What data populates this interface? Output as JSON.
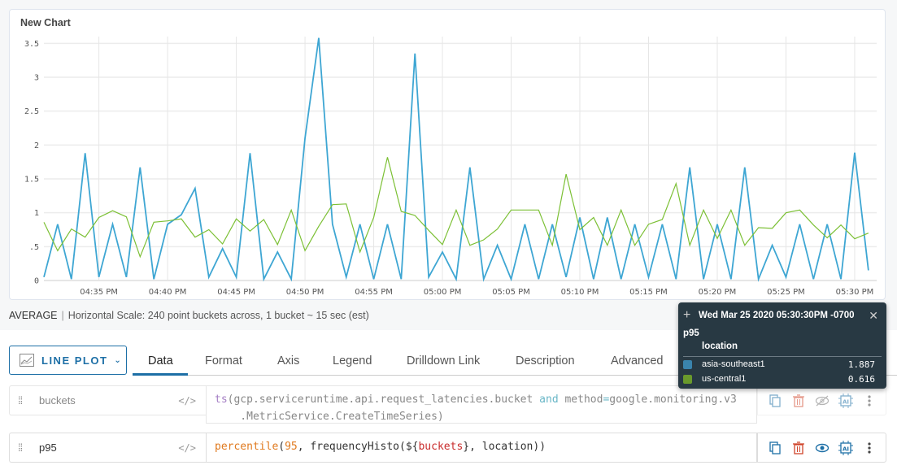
{
  "chart_data": {
    "type": "line",
    "title": "New Chart",
    "xlabel": "",
    "ylabel": "",
    "ylim": [
      0,
      3.6
    ],
    "yticks": [
      {
        "value": 0,
        "label": "0"
      },
      {
        "value": 0.5,
        "label": ".5"
      },
      {
        "value": 1,
        "label": "1"
      },
      {
        "value": 1.5,
        "label": "1.5"
      },
      {
        "value": 2,
        "label": "2"
      },
      {
        "value": 2.5,
        "label": "2.5"
      },
      {
        "value": 3,
        "label": "3"
      },
      {
        "value": 3.5,
        "label": "3.5"
      }
    ],
    "grid": true,
    "x_start": "04:31 PM",
    "x_step_minutes": 1,
    "xrange_minutes": [
      0,
      60.6
    ],
    "xticks": [
      {
        "minute": 4,
        "label": "04:35 PM"
      },
      {
        "minute": 9,
        "label": "04:40 PM"
      },
      {
        "minute": 14,
        "label": "04:45 PM"
      },
      {
        "minute": 19,
        "label": "04:50 PM"
      },
      {
        "minute": 24,
        "label": "04:55 PM"
      },
      {
        "minute": 29,
        "label": "05:00 PM"
      },
      {
        "minute": 34,
        "label": "05:05 PM"
      },
      {
        "minute": 39,
        "label": "05:10 PM"
      },
      {
        "minute": 44,
        "label": "05:15 PM"
      },
      {
        "minute": 49,
        "label": "05:20 PM"
      },
      {
        "minute": 54,
        "label": "05:25 PM"
      },
      {
        "minute": 59,
        "label": "05:30 PM"
      }
    ],
    "series": [
      {
        "name": "asia-southeast1",
        "color": "#3ea6d3",
        "values": [
          0.05,
          0.83,
          0.02,
          1.88,
          0.05,
          0.83,
          0.05,
          1.67,
          0.02,
          0.83,
          0.97,
          1.36,
          0.05,
          0.47,
          0.05,
          1.88,
          0.02,
          0.42,
          0.02,
          2.1,
          3.58,
          0.83,
          0.05,
          0.83,
          0.02,
          0.83,
          0.02,
          3.35,
          0.05,
          0.42,
          0.02,
          1.67,
          0.02,
          0.52,
          0.02,
          0.83,
          0.02,
          0.83,
          0.05,
          0.93,
          0.02,
          0.93,
          0.02,
          0.83,
          0.05,
          0.83,
          0.02,
          1.67,
          0.02,
          0.83,
          0.02,
          1.67,
          0.02,
          0.52,
          0.05,
          0.83,
          0.02,
          0.83,
          0.02,
          1.887,
          0.15
        ]
      },
      {
        "name": "us-central1",
        "color": "#7cc035",
        "values": [
          0.86,
          0.44,
          0.76,
          0.64,
          0.93,
          1.03,
          0.94,
          0.35,
          0.86,
          0.88,
          0.91,
          0.64,
          0.75,
          0.54,
          0.91,
          0.73,
          0.9,
          0.53,
          1.04,
          0.44,
          0.8,
          1.12,
          1.13,
          0.42,
          0.93,
          1.82,
          1.02,
          0.96,
          0.74,
          0.53,
          1.04,
          0.52,
          0.6,
          0.76,
          1.04,
          1.04,
          1.04,
          0.52,
          1.57,
          0.75,
          0.93,
          0.52,
          1.04,
          0.52,
          0.83,
          0.9,
          1.43,
          0.52,
          1.04,
          0.62,
          1.04,
          0.52,
          0.78,
          0.77,
          1.0,
          1.04,
          0.82,
          0.63,
          0.82,
          0.616,
          0.7
        ]
      }
    ],
    "legend": "none"
  },
  "scale_info": {
    "aggregation": "AVERAGE",
    "separator": "|",
    "text": "Horizontal Scale: 240 point buckets across, 1 bucket ~ 15 sec (est)"
  },
  "editor": {
    "plot_type": "LINE PLOT",
    "plot_type_icon": "line-chart-icon",
    "tabs": [
      {
        "label": "Data",
        "active": true
      },
      {
        "label": "Format",
        "active": false
      },
      {
        "label": "Axis",
        "active": false
      },
      {
        "label": "Legend",
        "active": false
      },
      {
        "label": "Drilldown Link",
        "active": false
      },
      {
        "label": "Description",
        "active": false
      },
      {
        "label": "Advanced",
        "active": false
      }
    ],
    "queries": [
      {
        "name": "buckets",
        "disabled": true,
        "expr_parts": {
          "fn": "ts",
          "p1": "(gcp.serviceruntime.api.request_latencies.bucket ",
          "and": "and",
          "p2": " method",
          "eq": "=",
          "p3": "google.monitoring.v3",
          "line2": "    .MetricService.CreateTimeSeries)"
        },
        "actions": [
          "copy-icon",
          "delete-icon",
          "eye-off-icon",
          "ai-icon",
          "more-icon"
        ]
      },
      {
        "name": "p95",
        "disabled": false,
        "expr_parts": {
          "fn": "percentile",
          "p1": "(",
          "num": "95",
          "p2": ", frequencyHisto(${",
          "var": "buckets",
          "p3": "}, location))"
        },
        "actions": [
          "copy-icon",
          "delete-icon",
          "eye-icon",
          "ai-icon",
          "more-icon"
        ]
      }
    ]
  },
  "tooltip": {
    "timestamp": "Wed Mar 25 2020 05:30:30PM -0700",
    "series_name": "p95",
    "group_header": "location",
    "rows": [
      {
        "label": "asia-southeast1",
        "value": "1.887",
        "color": "#3a84ad"
      },
      {
        "label": "us-central1",
        "value": "0.616",
        "color": "#6a9a2c"
      }
    ]
  }
}
